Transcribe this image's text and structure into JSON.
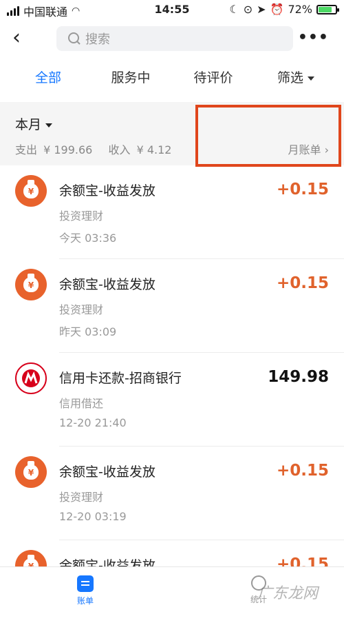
{
  "status_bar": {
    "carrier": "中国联通",
    "time": "14:55",
    "battery": "72%"
  },
  "header": {
    "search_placeholder": "搜索",
    "more": "•••"
  },
  "tabs": [
    {
      "label": "全部",
      "active": true
    },
    {
      "label": "服务中"
    },
    {
      "label": "待评价"
    },
    {
      "label": "筛选"
    }
  ],
  "summary": {
    "month": "本月",
    "expense_label": "支出",
    "expense": "¥ 199.66",
    "income_label": "收入",
    "income": "¥ 4.12",
    "monthly_bill": "月账单 ›"
  },
  "transactions": [
    {
      "title": "余额宝-收益发放",
      "category": "投资理财",
      "time": "今天  03:36",
      "amount": "+0.15",
      "type": "income"
    },
    {
      "title": "余额宝-收益发放",
      "category": "投资理财",
      "time": "昨天  03:09",
      "amount": "+0.15",
      "type": "income"
    },
    {
      "title": "信用卡还款-招商银行",
      "category": "信用借还",
      "time": "12-20  21:40",
      "amount": "149.98",
      "type": "expense"
    },
    {
      "title": "余额宝-收益发放",
      "category": "投资理财",
      "time": "12-20  03:19",
      "amount": "+0.15",
      "type": "income"
    },
    {
      "title": "余额宝-收益发放",
      "category": "",
      "time": "",
      "amount": "+0.15",
      "type": "income"
    }
  ],
  "bottom_nav": {
    "bill": "账单",
    "stats": "统计"
  },
  "watermark": "广东龙网",
  "colors": {
    "accent": "#1677ff",
    "income": "#e0622c",
    "highlight": "#e0461c",
    "bank": "#d7001b"
  }
}
